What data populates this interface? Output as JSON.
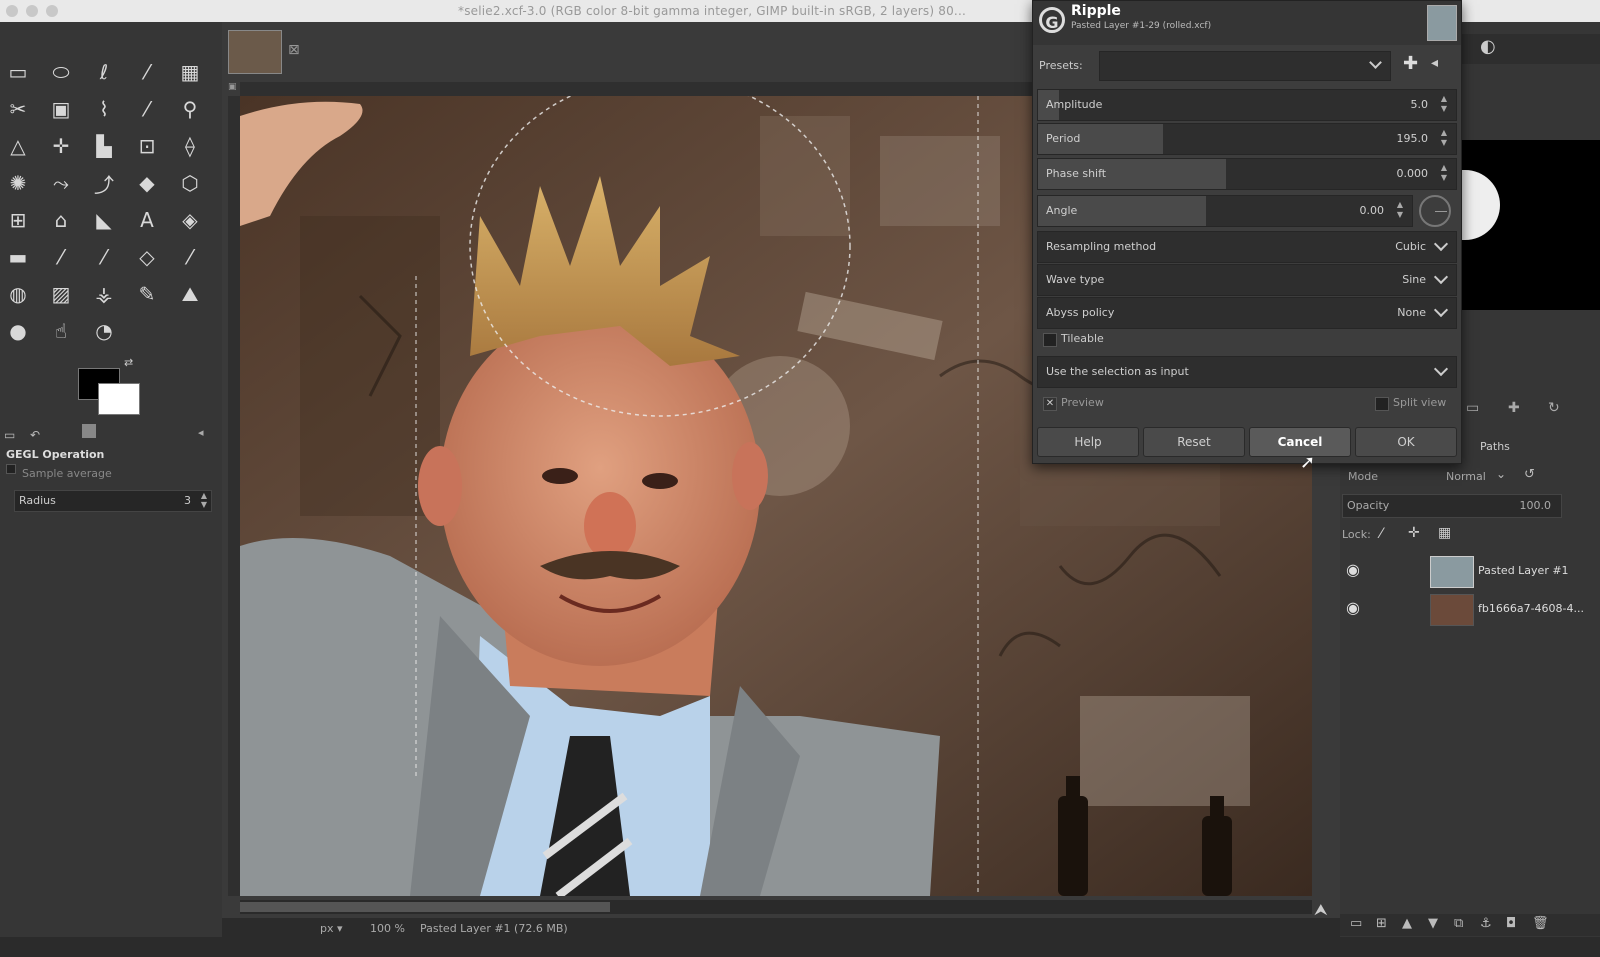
{
  "window": {
    "title": "*selie2.xcf-3.0 (RGB color 8-bit gamma integer, GIMP built-in sRGB, 2 layers) 80..."
  },
  "toolbox": {
    "tools": [
      "rect-select-icon",
      "ellipse-select-icon",
      "free-select-icon",
      "fuzzy-select-icon",
      "color-select-icon",
      "scissors-icon",
      "foreground-select-icon",
      "paths-icon",
      "color-picker-icon",
      "zoom-icon",
      "measure-icon",
      "move-icon",
      "align-icon",
      "crop-icon",
      "unified-transform-icon",
      "warp-transform-icon",
      "handle-transform-icon",
      "shear-icon",
      "perspective-icon",
      "3d-transform-icon",
      "flip-icon",
      "cage-icon",
      "smudge-bucket-icon",
      "text-icon",
      "bucket-fill-icon",
      "gradient-icon",
      "pencil-icon",
      "paintbrush-icon",
      "eraser-icon",
      "airbrush-icon",
      "ink-icon",
      "mypaint-brush-icon",
      "clone-icon",
      "heal-icon",
      "perspective-clone-icon",
      "blur-icon",
      "smudge-icon",
      "dodge-burn-icon"
    ],
    "fg_color": "#000000",
    "bg_color": "#ffffff",
    "gegl_operation_title": "GEGL Operation",
    "sample_average": "Sample average",
    "radius_label": "Radius",
    "radius_value": "3"
  },
  "canvas": {
    "status_zoom": "100 %",
    "status_layer": "Pasted Layer #1 (72.6 MB)"
  },
  "dialog": {
    "title": "Ripple",
    "subtitle": "Pasted Layer #1-29 (rolled.xcf)",
    "presets_label": "Presets:",
    "presets_value": "",
    "amplitude_label": "Amplitude",
    "amplitude_value": "5.0",
    "amplitude_fraction": 0.05,
    "period_label": "Period",
    "period_value": "195.0",
    "period_fraction": 0.3,
    "phase_label": "Phase shift",
    "phase_value": "0.000",
    "phase_fraction": 0.45,
    "angle_label": "Angle",
    "angle_value": "0.00",
    "angle_fraction": 0.45,
    "resampling_label": "Resampling method",
    "resampling_value": "Cubic",
    "wave_label": "Wave type",
    "wave_value": "Sine",
    "abyss_label": "Abyss policy",
    "abyss_value": "None",
    "tileable_label": "Tileable",
    "input_select": "Use the selection as input",
    "preview_label": "Preview",
    "split_view_label": "Split view",
    "help_button": "Help",
    "reset_button": "Reset",
    "cancel_button": "Cancel",
    "ok_button": "OK"
  },
  "layers": {
    "tabs_label": "Paths",
    "mode_label": "Mode",
    "mode_value": "Normal",
    "opacity_label": "Opacity",
    "opacity_value": "100.0",
    "lock_label": "Lock:",
    "items": [
      {
        "name": "Pasted Layer #1"
      },
      {
        "name": "fb1666a7-4608-4..."
      }
    ]
  }
}
